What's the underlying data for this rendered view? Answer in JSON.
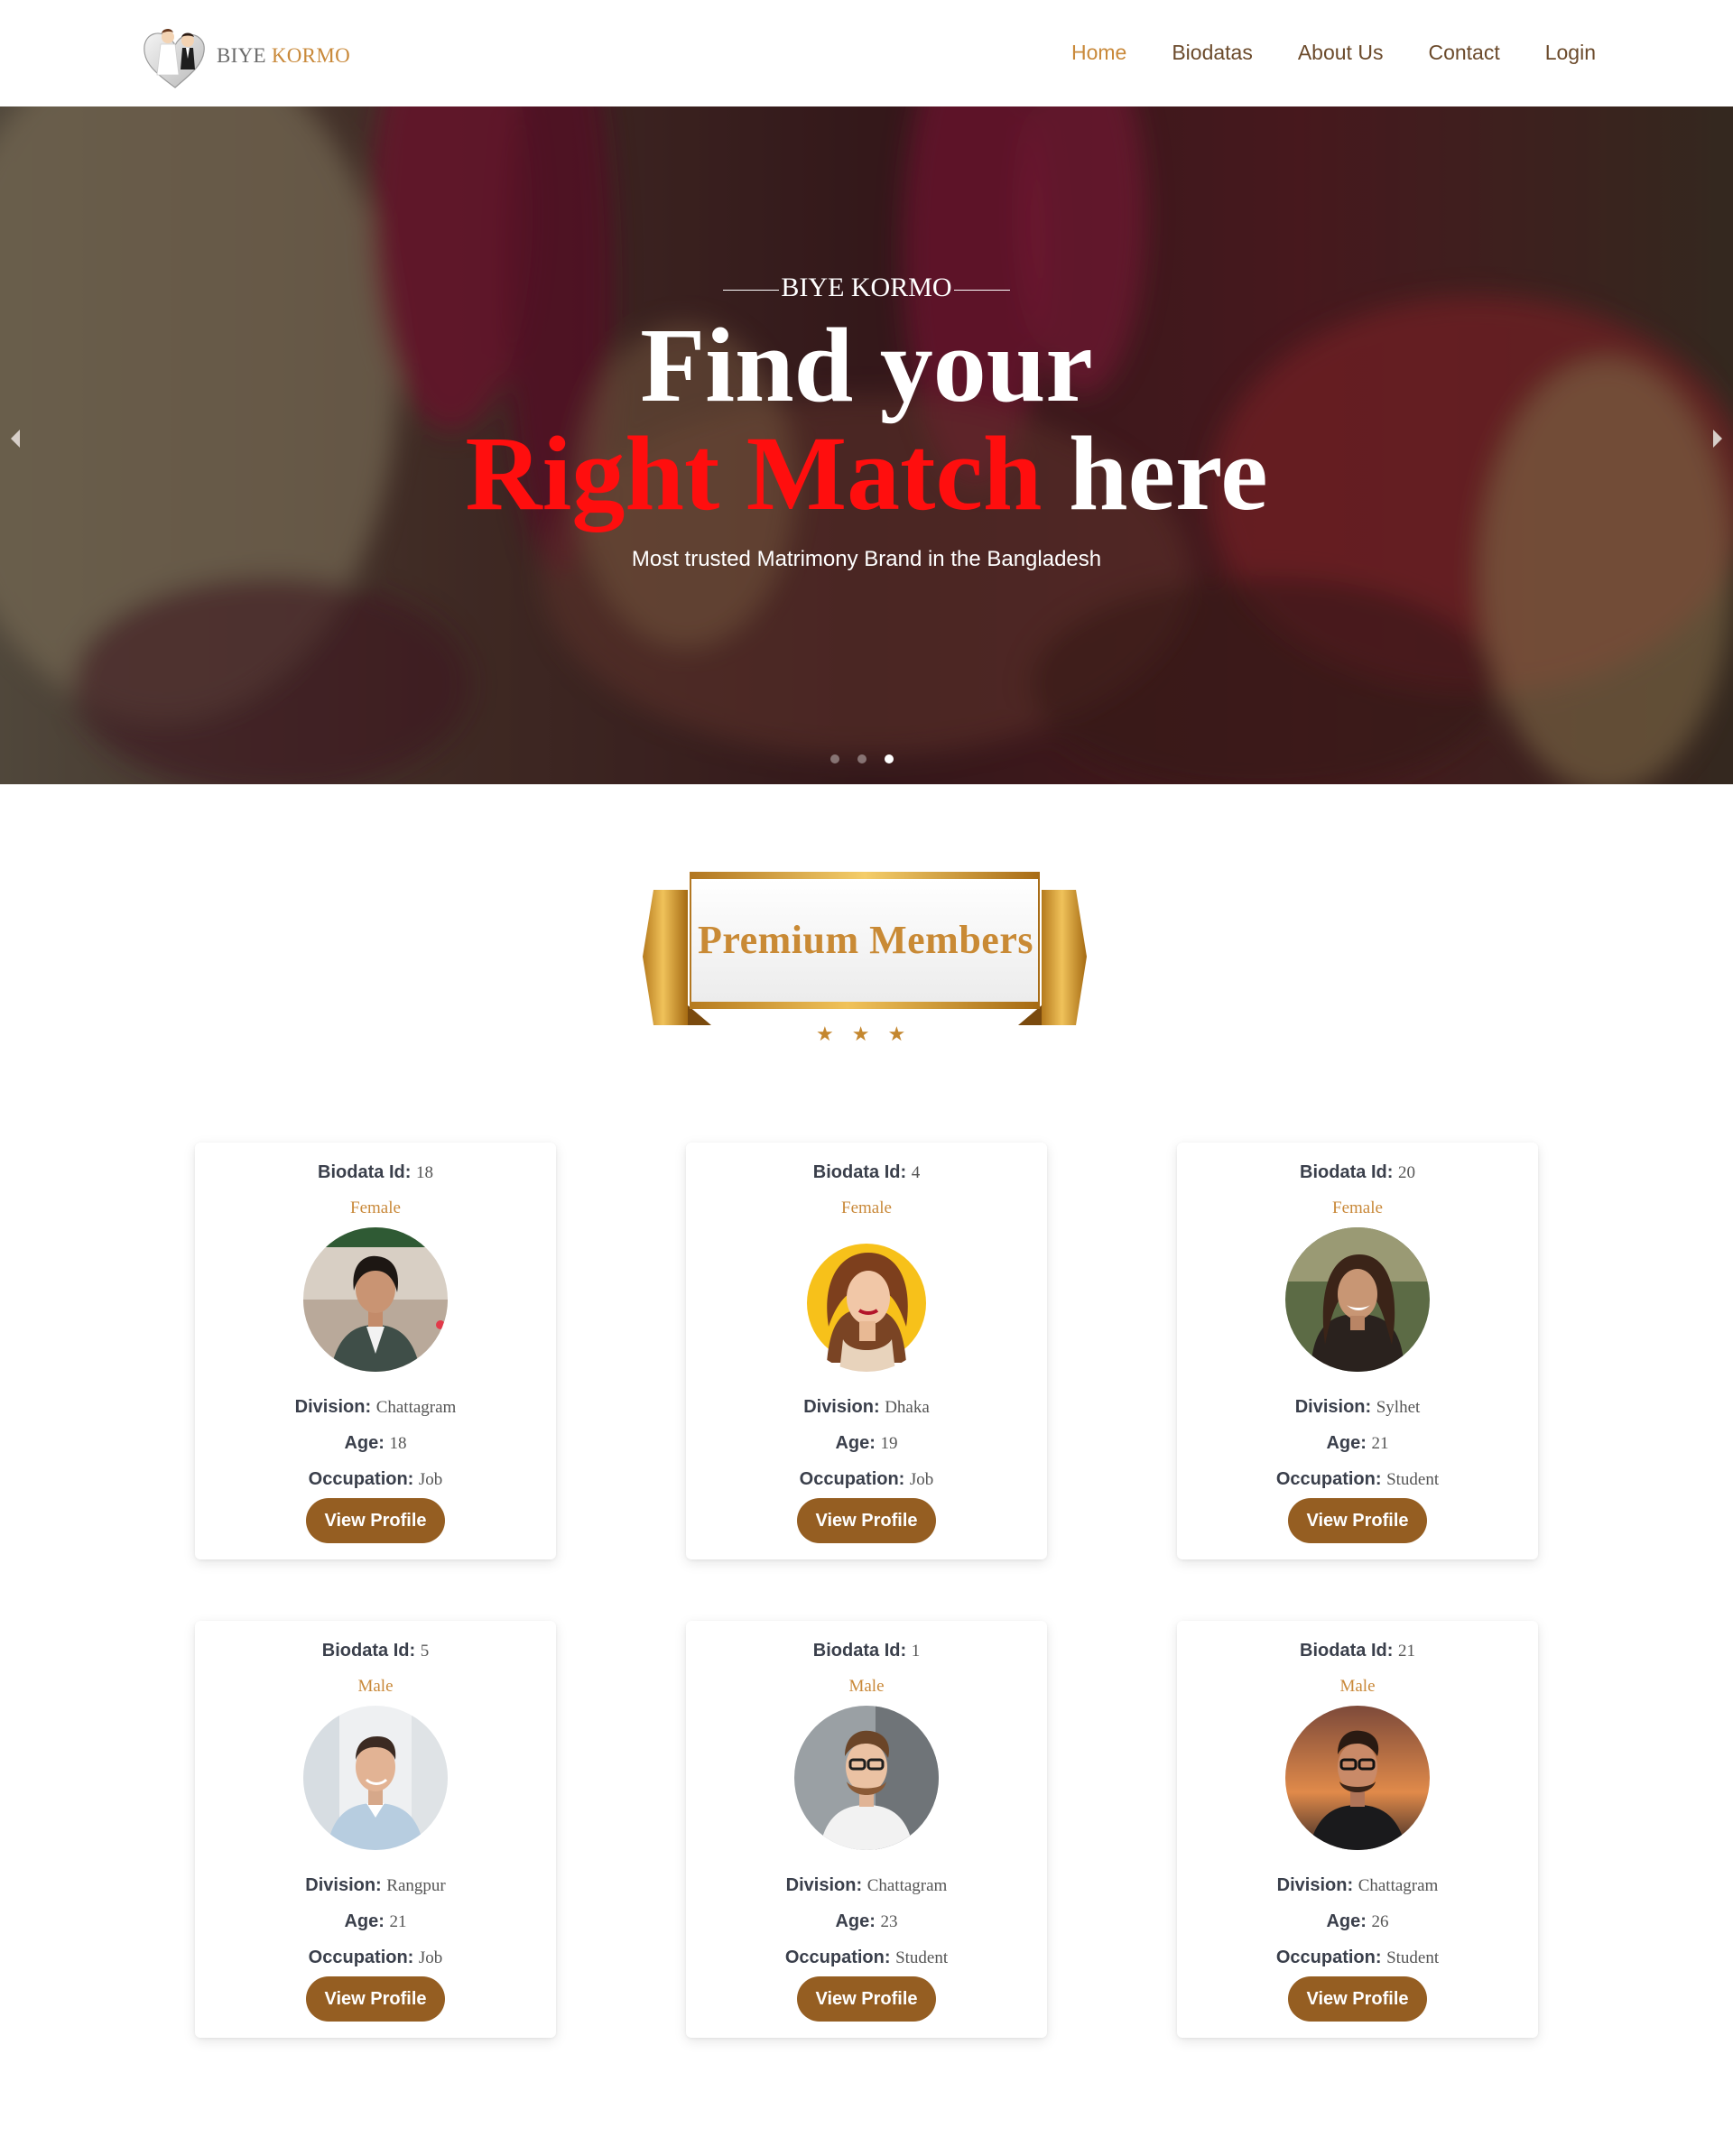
{
  "header": {
    "logo_icon": "bride-groom-heart-icon",
    "logo_word1": "BIYE",
    "logo_word2": "KORMO",
    "nav": [
      {
        "label": "Home",
        "active": true
      },
      {
        "label": "Biodatas",
        "active": false
      },
      {
        "label": "About Us",
        "active": false
      },
      {
        "label": "Contact",
        "active": false
      },
      {
        "label": "Login",
        "active": false
      }
    ]
  },
  "hero": {
    "kicker": "BIYE KORMO",
    "line1": "Find your",
    "line2_highlight": "Right Match",
    "line2_rest": " here",
    "subtitle": "Most trusted Matrimony Brand in the Bangladesh",
    "slides": 3,
    "active_slide": 3,
    "prev_icon": "chevron-left-icon",
    "next_icon": "chevron-right-icon"
  },
  "premium": {
    "title": "Premium Members",
    "stars": [
      "★",
      "★",
      "★"
    ]
  },
  "labels": {
    "biodata_id": "Biodata Id:",
    "division": "Division:",
    "age": "Age:",
    "occupation": "Occupation:",
    "view_profile": "View Profile"
  },
  "members": [
    {
      "id": "18",
      "gender": "Female",
      "division": "Chattagram",
      "age": "18",
      "occupation": "Job"
    },
    {
      "id": "4",
      "gender": "Female",
      "division": "Dhaka",
      "age": "19",
      "occupation": "Job"
    },
    {
      "id": "20",
      "gender": "Female",
      "division": "Sylhet",
      "age": "21",
      "occupation": "Student"
    },
    {
      "id": "5",
      "gender": "Male",
      "division": "Rangpur",
      "age": "21",
      "occupation": "Job"
    },
    {
      "id": "1",
      "gender": "Male",
      "division": "Chattagram",
      "age": "23",
      "occupation": "Student"
    },
    {
      "id": "21",
      "gender": "Male",
      "division": "Chattagram",
      "age": "26",
      "occupation": "Student"
    }
  ],
  "colors": {
    "accent": "#c9893a",
    "button": "#955e22",
    "highlight_red": "#ff0e0e"
  }
}
